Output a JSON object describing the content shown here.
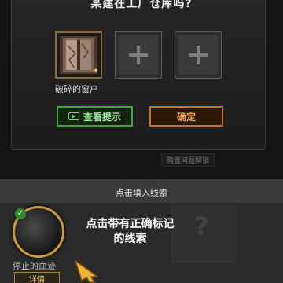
{
  "question": "某建在工厂仓库吗?",
  "slots": {
    "filled_label": "破碎的窗户"
  },
  "buttons": {
    "hint": "查看提示",
    "confirm": "确定"
  },
  "faded_label": "购置间题解锁",
  "bottom": {
    "title": "点击填入线索",
    "clue_label": "停止的血迹",
    "detail_button": "详情"
  },
  "tutorial": {
    "line1": "点击带有正确标记",
    "line2": "的线索"
  },
  "colors": {
    "hint_green": "#3ea53a",
    "confirm_orange": "#c8731d",
    "clue_gold": "#c99a3b"
  }
}
